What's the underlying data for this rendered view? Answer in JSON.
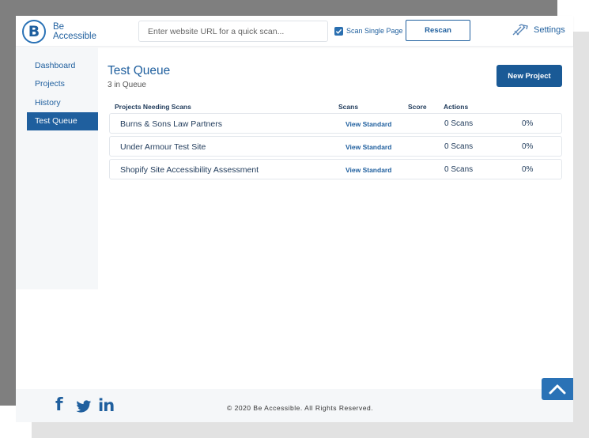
{
  "header": {
    "logo_line1": "Be",
    "logo_line2": "Accessible",
    "logo_letter": "B",
    "search_placeholder": "Enter website URL for a quick scan...",
    "scan_single_label": "Scan Single Page",
    "scan_single_checked": true,
    "rescan_label": "Rescan",
    "settings_label": "Settings"
  },
  "sidebar": {
    "items": [
      {
        "label": "Dashboard",
        "active": false
      },
      {
        "label": "Projects",
        "active": false
      },
      {
        "label": "History",
        "active": false
      },
      {
        "label": "Test Queue",
        "active": true
      }
    ]
  },
  "main": {
    "title": "Test Queue",
    "subtitle": "3 in Queue",
    "new_project_label": "New Project",
    "columns": [
      "Projects Needing Scans",
      "Scans",
      "Score",
      "Actions"
    ],
    "rows": [
      {
        "name": "Burns & Sons Law Partners",
        "scan_link": "View Standard",
        "scans": "0 Scans",
        "score": "0%"
      },
      {
        "name": "Under Armour Test Site",
        "scan_link": "View Standard",
        "scans": "0 Scans",
        "score": "0%"
      },
      {
        "name": "Shopify Site Accessibility Assessment",
        "scan_link": "View Standard",
        "scans": "0 Scans",
        "score": "0%"
      }
    ]
  },
  "footer": {
    "copyright": "© 2020 Be Accessible. All Rights Reserved.",
    "social": [
      "facebook-icon",
      "twitter-icon",
      "linkedin-icon"
    ]
  },
  "colors": {
    "brand_blue": "#1f5f9e",
    "button_blue": "#1a5a96",
    "sidebar_bg": "#f5f7f9"
  }
}
